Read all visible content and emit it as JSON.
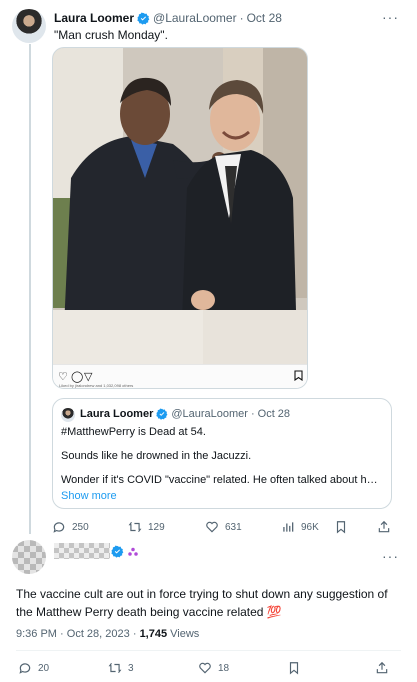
{
  "post1": {
    "author_name": "Laura Loomer",
    "handle": "@LauraLoomer",
    "separator": "·",
    "date": "Oct 28",
    "text": "\"Man crush Monday\".",
    "more_icon": "more-icon",
    "image": {
      "alt": "Barack Obama laughing with Matthew Perry",
      "liked_by": "Liked by jiralondrew and 1,032,098 others"
    },
    "quote": {
      "author_name": "Laura Loomer",
      "handle": "@LauraLoomer",
      "separator": "·",
      "date": "Oct 28",
      "line1": "#MatthewPerry is Dead at 54.",
      "line2": "Sounds like he drowned in the Jacuzzi.",
      "line3": "Wonder if it's COVID \"vaccine\" related. He often talked about how he w...",
      "show_more": "Show more"
    },
    "stats": {
      "replies": "250",
      "reposts": "129",
      "likes": "631",
      "views": "96K"
    }
  },
  "post2": {
    "text": "The vaccine cult are out in force trying to shut down any suggestion of the Matthew Perry death being vaccine related 💯",
    "time": "9:36 PM",
    "separator1": "·",
    "date": "Oct 28, 2023",
    "separator2": "·",
    "views_count": "1,745",
    "views_label": "Views",
    "stats": {
      "replies": "20",
      "reposts": "3",
      "likes": "18"
    }
  },
  "colors": {
    "verified": "#1d9bf0",
    "muted": "#536471",
    "link": "#1d9bf0",
    "affiliate": "#b04bd8"
  }
}
